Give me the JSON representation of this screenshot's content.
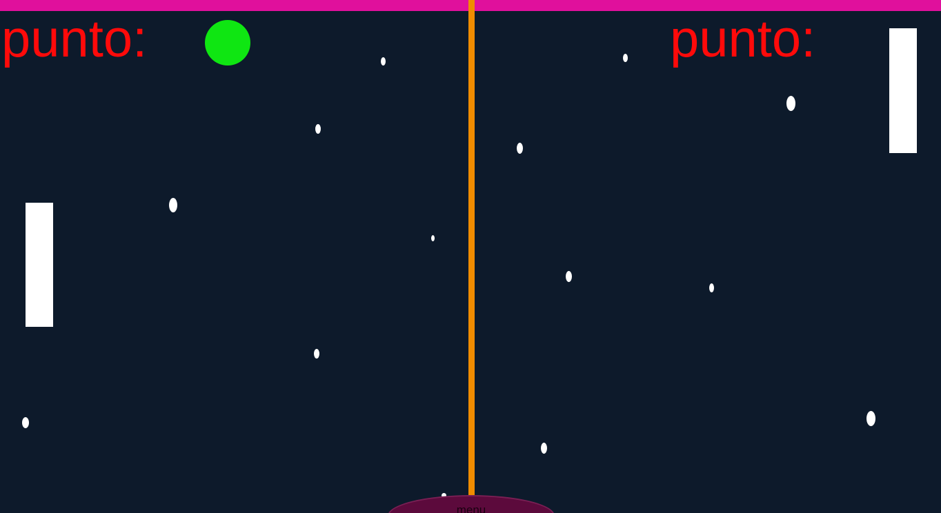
{
  "scoreboard": {
    "left_label": "punto:",
    "right_label": "punto:"
  },
  "menu": {
    "label": "menu"
  },
  "colors": {
    "background": "#0d1a2b",
    "top_bar": "#e0109c",
    "center_line": "#f08c00",
    "score_text": "#ff0a0a",
    "ball": "#0fe612",
    "paddle": "#ffffff",
    "star": "#ffffff",
    "menu_button": "#5c0a3c"
  }
}
